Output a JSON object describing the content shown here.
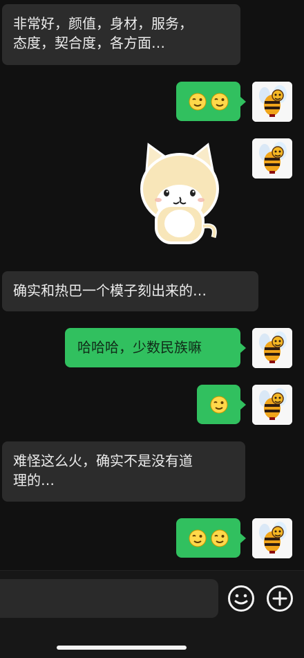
{
  "messages": [
    {
      "side": "left",
      "lines": [
        "非常好，颜值，身材，服务，",
        "态度，契合度，各方面…"
      ]
    },
    {
      "side": "right",
      "emojis": [
        "wink-smile-icon",
        "wink-smile-icon"
      ]
    },
    {
      "side": "right",
      "sticker": "cat-sticker"
    },
    {
      "side": "left",
      "lines": [
        "确实和热巴一个模子刻出来的…"
      ]
    },
    {
      "side": "right",
      "text": "哈哈哈，少数民族嘛"
    },
    {
      "side": "right",
      "emojis": [
        "wink-smile-icon"
      ]
    },
    {
      "side": "left",
      "lines": [
        "难怪这么火，确实不是没有道",
        "理的…"
      ]
    },
    {
      "side": "right",
      "emojis": [
        "wink-smile-icon",
        "wink-smile-icon"
      ]
    }
  ],
  "composer": {
    "emoji_icon": "smile-icon",
    "add_icon": "plus-icon"
  },
  "colors": {
    "background": "#111111",
    "left_bubble": "#2c2c2c",
    "right_bubble": "#31c05f",
    "bottom_bar": "#171717"
  }
}
